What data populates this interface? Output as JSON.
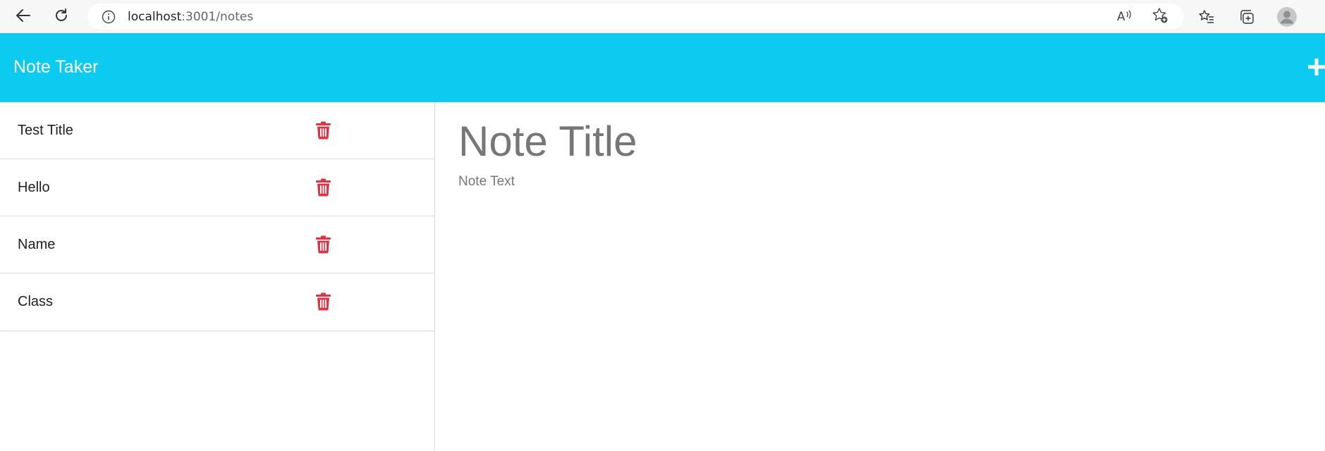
{
  "browser": {
    "url_host": "localhost",
    "url_path": ":3001/notes"
  },
  "app": {
    "title": "Note Taker",
    "accent_color": "#0dcaf0",
    "delete_color": "#dc3545"
  },
  "notes": [
    {
      "title": "Test Title"
    },
    {
      "title": "Hello"
    },
    {
      "title": "Name"
    },
    {
      "title": "Class"
    }
  ],
  "editor": {
    "title_placeholder": "Note Title",
    "text_placeholder": "Note Text"
  },
  "icons": {
    "back": "arrow-left-icon",
    "refresh": "refresh-icon",
    "info": "info-icon",
    "read_aloud": "read-aloud-icon",
    "add_favorite": "star-add-icon",
    "favorites": "favorites-icon",
    "collections": "collections-icon",
    "profile": "profile-avatar-icon",
    "add_note": "plus-icon",
    "delete": "trash-icon"
  }
}
